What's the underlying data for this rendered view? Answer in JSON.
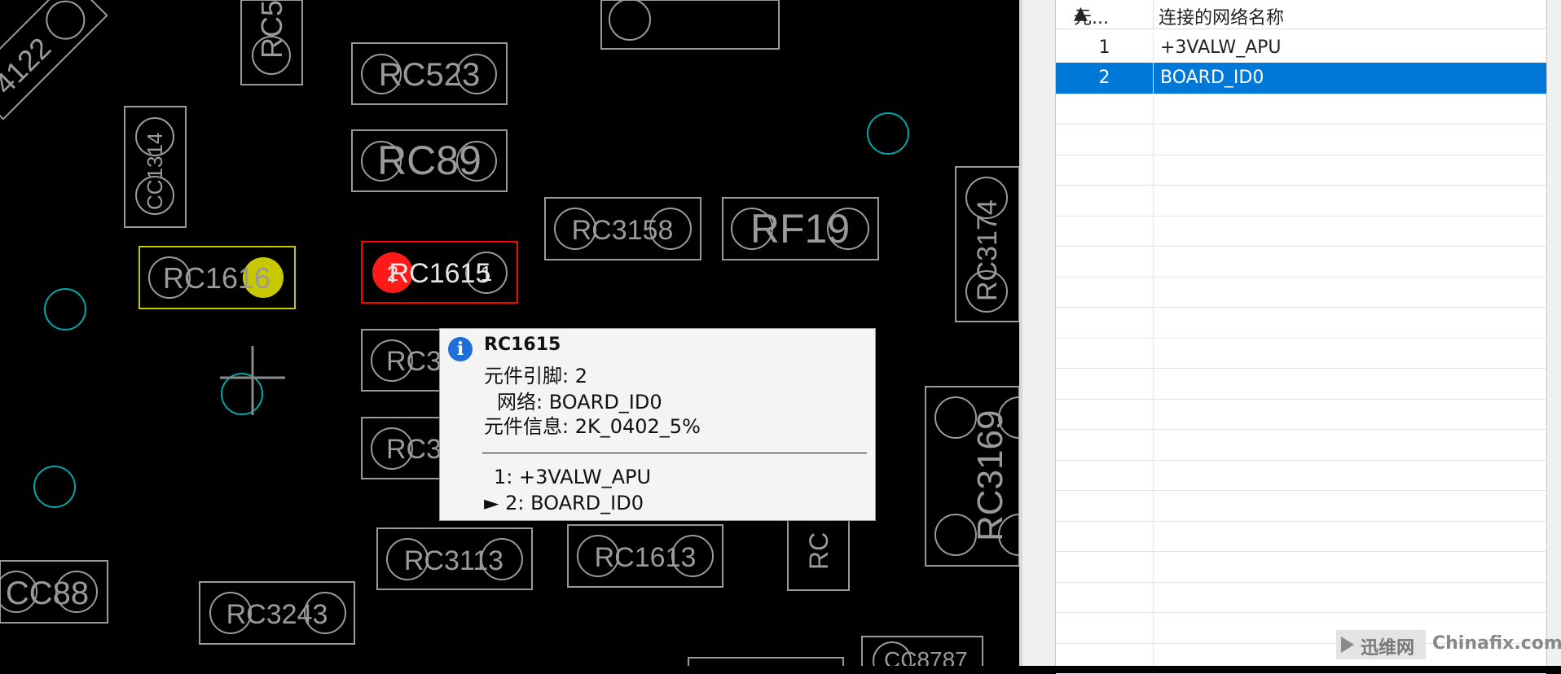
{
  "pcb": {
    "components": [
      "RC523",
      "RC89",
      "CC1314",
      "RC1616",
      "RC1615",
      "RC3158",
      "RF19",
      "RC3174",
      "RC3169",
      "RC3113",
      "RC1613",
      "CC88",
      "RC3243",
      "RC5",
      "RC3",
      "RC3",
      "RC",
      "4122",
      "CC8787"
    ],
    "pad_labels": {
      "left": "2",
      "right": "1"
    },
    "highlight_color": "#ff0000",
    "selected_pad_color": "#ff1a1a",
    "yellow_pad_color": "#c8c800",
    "via_color": "#00b3b3"
  },
  "tooltip": {
    "title": "RC1615",
    "pin_line": "元件引脚: 2",
    "net_line": "网络: BOARD_ID0",
    "info_line": "元件信息: 2K_0402_5%",
    "pin1": "1: +3VALW_APU",
    "pin2": "► 2: BOARD_ID0",
    "icon": "info-icon"
  },
  "panel": {
    "headers": {
      "col1": "元...",
      "col2": "连接的网络名称"
    },
    "rows": [
      {
        "idx": "1",
        "net": "+3VALW_APU",
        "selected": false
      },
      {
        "idx": "2",
        "net": "BOARD_ID0",
        "selected": true
      }
    ]
  },
  "watermark": {
    "cn": "迅维网",
    "en": "Chinafix.com"
  }
}
